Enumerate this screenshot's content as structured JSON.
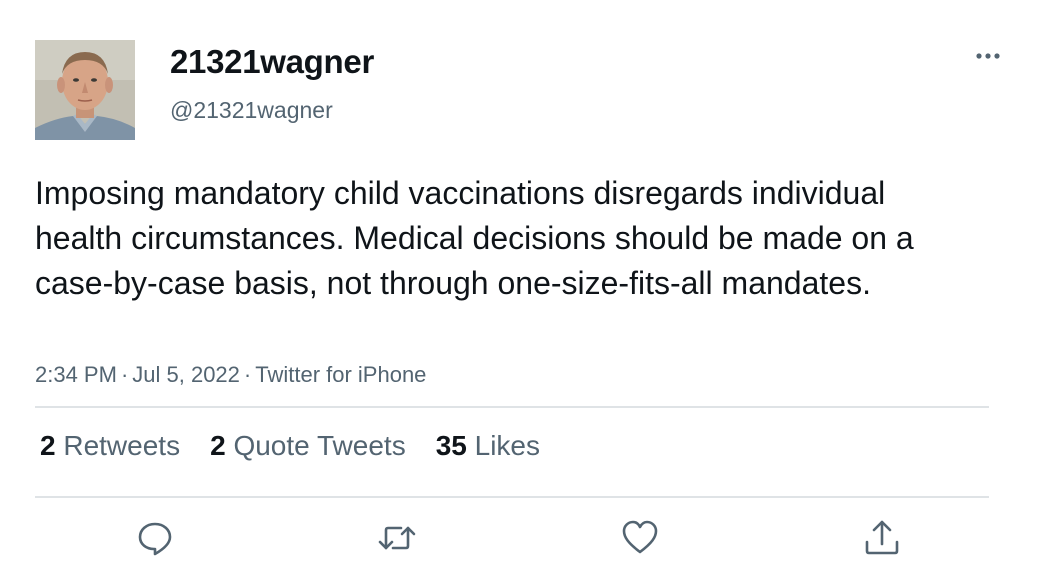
{
  "user": {
    "display_name": "21321wagner",
    "handle": "@21321wagner"
  },
  "tweet": {
    "text": "Imposing mandatory child vaccinations disregards individual health circumstances. Medical decisions should be made on a case-by-case basis, not through one-size-fits-all mandates.",
    "time": "2:34 PM",
    "date": "Jul 5, 2022",
    "source": "Twitter for iPhone",
    "separator": "·"
  },
  "stats": {
    "retweets_count": "2",
    "retweets_label": "Retweets",
    "quotes_count": "2",
    "quotes_label": "Quote Tweets",
    "likes_count": "35",
    "likes_label": "Likes"
  },
  "icons": {
    "more": "more-horizontal-icon",
    "reply": "reply-icon",
    "retweet": "retweet-icon",
    "like": "heart-icon",
    "share": "share-icon"
  },
  "colors": {
    "text_primary": "#0f1419",
    "text_secondary": "#536471",
    "divider": "#dfe3e6",
    "icon": "#536471"
  }
}
